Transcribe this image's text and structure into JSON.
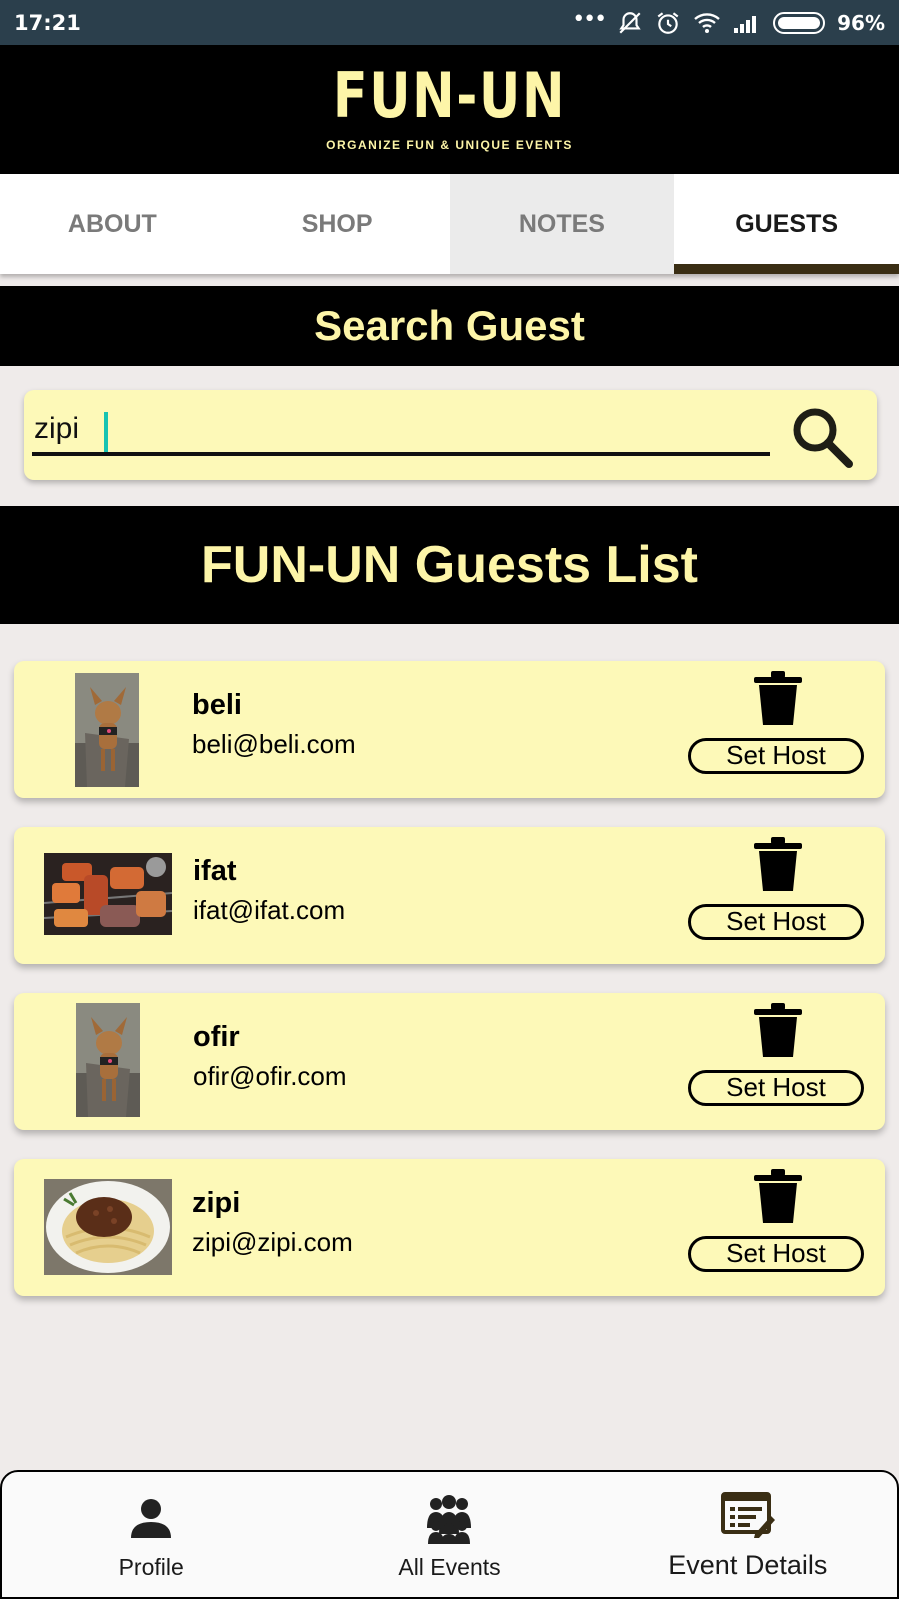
{
  "status_bar": {
    "time": "17:21",
    "battery_percent": "96%",
    "icons": [
      "more-dots-icon",
      "bell-off-icon",
      "alarm-icon",
      "wifi-icon",
      "signal-icon",
      "battery-icon"
    ]
  },
  "brand": {
    "logo": "FUN-UN",
    "tagline": "ORGANIZE FUN & UNIQUE EVENTS"
  },
  "tabs": [
    {
      "label": "ABOUT"
    },
    {
      "label": "SHOP"
    },
    {
      "label": "NOTES"
    },
    {
      "label": "GUESTS"
    }
  ],
  "active_tab": "GUESTS",
  "search": {
    "title": "Search Guest",
    "value": "zipi"
  },
  "guests_list": {
    "title": "FUN-UN Guests List",
    "set_host_label": "Set Host",
    "guests": [
      {
        "name": "beli",
        "email": "beli@beli.com",
        "photo": "dog-photo"
      },
      {
        "name": "ifat",
        "email": "ifat@ifat.com",
        "photo": "grilled-meat-photo"
      },
      {
        "name": "ofir",
        "email": "ofir@ofir.com",
        "photo": "dog-photo"
      },
      {
        "name": "zipi",
        "email": "zipi@zipi.com",
        "photo": "spaghetti-photo"
      }
    ]
  },
  "bottom_nav": [
    {
      "label": "Profile",
      "icon": "person-icon"
    },
    {
      "label": "All Events",
      "icon": "group-icon"
    },
    {
      "label": "Event Details",
      "icon": "edit-document-icon"
    }
  ],
  "colors": {
    "accent_yellow": "#fdf5a8",
    "card": "#fdf9b8",
    "status_bar": "#2b3f4c",
    "cursor": "#17c3b2"
  }
}
